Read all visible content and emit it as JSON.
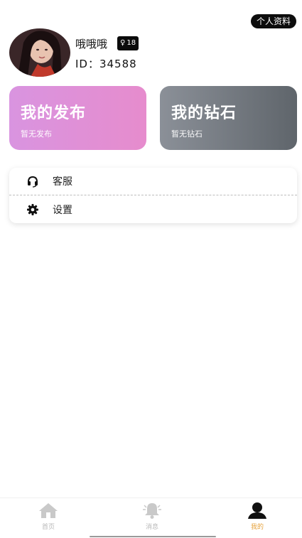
{
  "header": {
    "profile_button": "个人资料"
  },
  "user": {
    "name": "哦哦哦",
    "badge_symbol": "♀",
    "age": "18",
    "id": "ID：34588"
  },
  "cards": [
    {
      "title": "我的发布",
      "subtitle": "暂无发布",
      "icon": "none"
    },
    {
      "title": "我的钻石",
      "subtitle": "暂无钻石",
      "icon": "none"
    }
  ],
  "menu": [
    {
      "label": "客服",
      "icon": "headset-icon"
    },
    {
      "label": "设置",
      "icon": "gear-icon"
    }
  ],
  "tabs": [
    {
      "label": "首页",
      "icon": "home-icon",
      "active": false
    },
    {
      "label": "消息",
      "icon": "bell-icon",
      "active": false
    },
    {
      "label": "我的",
      "icon": "user-icon",
      "active": true
    }
  ],
  "colors": {
    "posts_card_start": "#d994e0",
    "posts_card_end": "#e68ccd",
    "diamonds_card_start": "#8b9098",
    "diamonds_card_end": "#5f656b",
    "active_tab": "#e6a23c",
    "inactive_tab": "#b8b8b8"
  }
}
